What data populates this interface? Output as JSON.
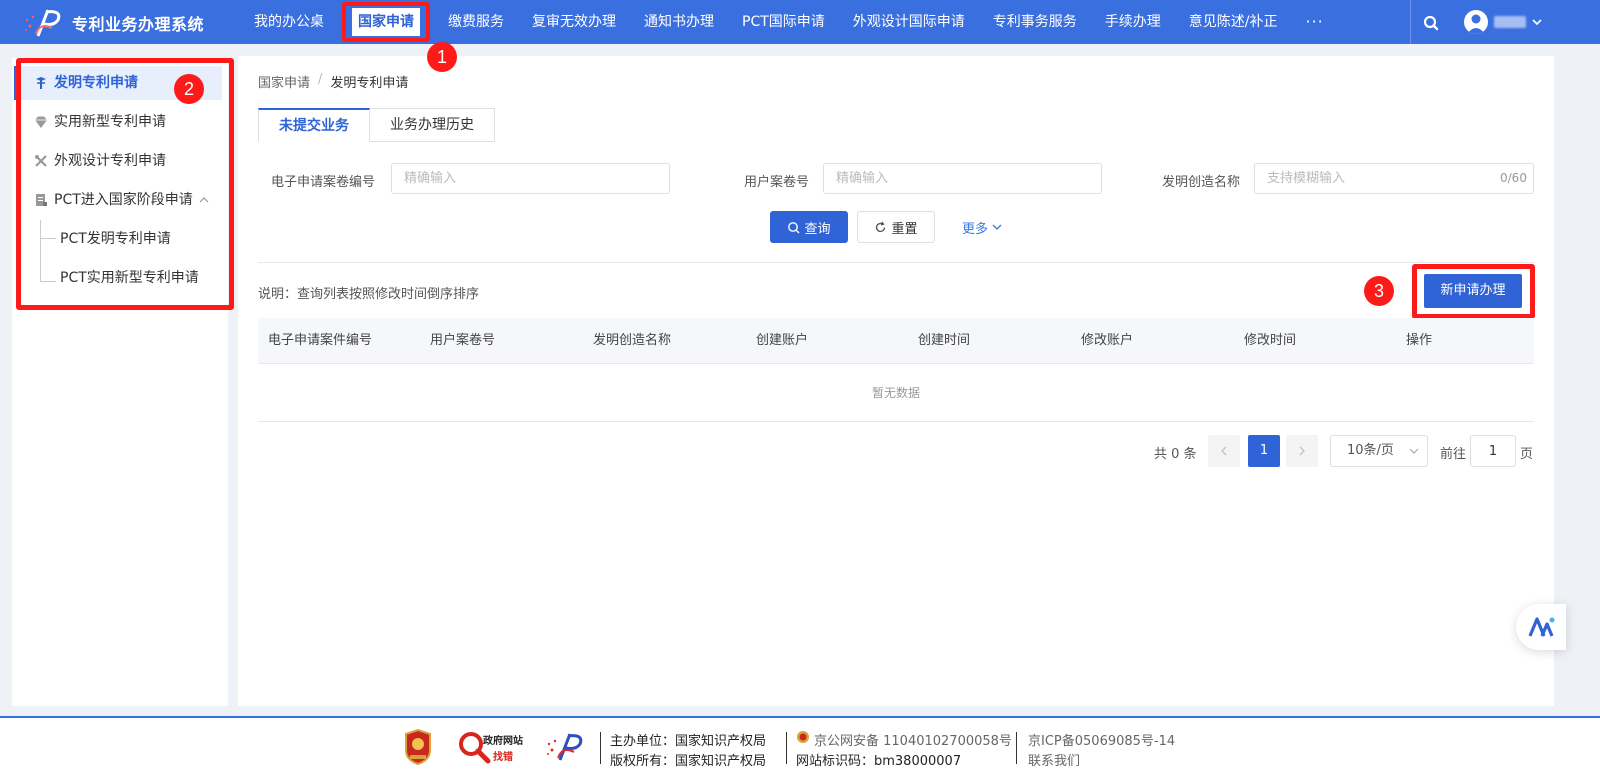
{
  "app": {
    "title": "专利业务办理系统"
  },
  "nav": {
    "items": [
      {
        "label": "我的办公桌"
      },
      {
        "label": "国家申请"
      },
      {
        "label": "缴费服务"
      },
      {
        "label": "复审无效办理"
      },
      {
        "label": "通知书办理"
      },
      {
        "label": "PCT国际申请"
      },
      {
        "label": "外观设计国际申请"
      },
      {
        "label": "专利事务服务"
      },
      {
        "label": "手续办理"
      },
      {
        "label": "意见陈述/补正"
      }
    ],
    "more": "···"
  },
  "badges": [
    "1",
    "2",
    "3"
  ],
  "sidebar": {
    "items": [
      {
        "label": "发明专利申请",
        "icon": "invention-icon"
      },
      {
        "label": "实用新型专利申请",
        "icon": "diamond-icon"
      },
      {
        "label": "外观设计专利申请",
        "icon": "design-tools-icon"
      },
      {
        "label": "PCT进入国家阶段申请",
        "icon": "document-icon"
      }
    ],
    "sub_items": [
      {
        "label": "PCT发明专利申请"
      },
      {
        "label": "PCT实用新型专利申请"
      }
    ]
  },
  "breadcrumb": {
    "parent": "国家申请",
    "separator": "/",
    "current": "发明专利申请"
  },
  "tabs": [
    {
      "label": "未提交业务"
    },
    {
      "label": "业务办理历史"
    }
  ],
  "form": {
    "case_no_label": "电子申请案卷编号",
    "case_no_placeholder": "精确输入",
    "user_no_label": "用户案卷号",
    "user_no_placeholder": "精确输入",
    "name_label": "发明创造名称",
    "name_placeholder": "支持模糊输入",
    "name_count": "0/60",
    "query_btn": "查询",
    "reset_btn": "重置",
    "more_btn": "更多"
  },
  "note": "说明：查询列表按照修改时间倒序排序",
  "new_btn": "新申请办理",
  "table": {
    "headers": [
      "电子申请案件编号",
      "用户案卷号",
      "发明创造名称",
      "创建账户",
      "创建时间",
      "修改账户",
      "修改时间",
      "操作"
    ],
    "empty": "暂无数据"
  },
  "pagination": {
    "total": "共 0 条",
    "current": "1",
    "page_size": "10条/页",
    "goto_label": "前往",
    "goto_value": "1",
    "page_label": "页"
  },
  "footer": {
    "gov_label_top": "政府网站",
    "gov_label_bottom": "找错",
    "sponsor": "主办单位：国家知识产权局",
    "copyright": "版权所有：国家知识产权局",
    "police": "京公网安备 11040102700058号",
    "site_code": "网站标识码：bm38000007",
    "icp": "京ICP备05069085号-14",
    "contact": "联系我们"
  },
  "colors": {
    "primary": "#3a6fe0",
    "accent": "#2f63d6",
    "highlight": "#ff1a1a"
  }
}
